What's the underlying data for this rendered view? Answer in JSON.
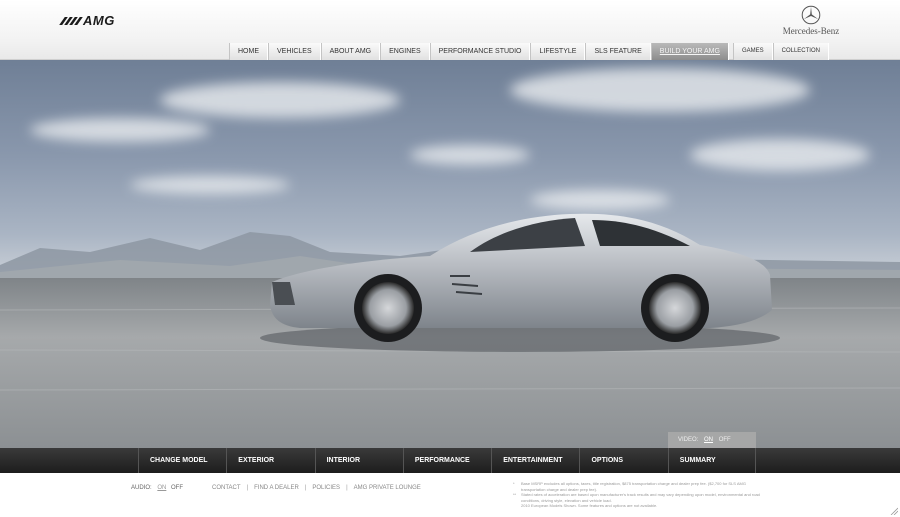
{
  "brand": {
    "amg_logo_text": "AMG",
    "mercedes_text": "Mercedes-Benz"
  },
  "topnav": [
    {
      "label": "HOME",
      "name": "nav-home"
    },
    {
      "label": "VEHICLES",
      "name": "nav-vehicles"
    },
    {
      "label": "ABOUT AMG",
      "name": "nav-about-amg"
    },
    {
      "label": "ENGINES",
      "name": "nav-engines"
    },
    {
      "label": "PERFORMANCE STUDIO",
      "name": "nav-performance-studio"
    },
    {
      "label": "LIFESTYLE",
      "name": "nav-lifestyle"
    },
    {
      "label": "SLS FEATURE",
      "name": "nav-sls-feature"
    },
    {
      "label": "BUILD YOUR AMG",
      "name": "nav-build-your-amg",
      "active": true
    },
    {
      "label": "GAMES",
      "name": "nav-games"
    },
    {
      "label": "COLLECTION",
      "name": "nav-collection"
    }
  ],
  "video": {
    "label": "VIDEO:",
    "on": "ON",
    "off": "OFF"
  },
  "build_tabs": [
    "CHANGE MODEL",
    "EXTERIOR",
    "INTERIOR",
    "PERFORMANCE",
    "ENTERTAINMENT",
    "OPTIONS",
    "SUMMARY"
  ],
  "footer": {
    "audio_label": "AUDIO:",
    "audio_on": "ON",
    "audio_off": "OFF",
    "links": [
      "CONTACT",
      "FIND A DEALER",
      "POLICIES",
      "AMG PRIVATE LOUNGE"
    ],
    "disclaimer_bullet_1": "*",
    "disclaimer_1": "Base MSRP excludes all options, taxes, title registration, $875 transportation charge and dealer prep fee. ($2,700 for SLS AMG transportation charge and dealer prep fee).",
    "disclaimer_bullet_2": "**",
    "disclaimer_2": "Stated rates of acceleration are based upon manufacturer's track results and may vary depending upon model, environmental and road conditions, driving style, elevation and vehicle load.",
    "disclaimer_3": "2010 European Models Shown. Some features and options are not available."
  },
  "colors": {
    "bottombar": "#262626",
    "nav_active": "#9f9f9f",
    "car_silver": "#b8bcc2"
  }
}
